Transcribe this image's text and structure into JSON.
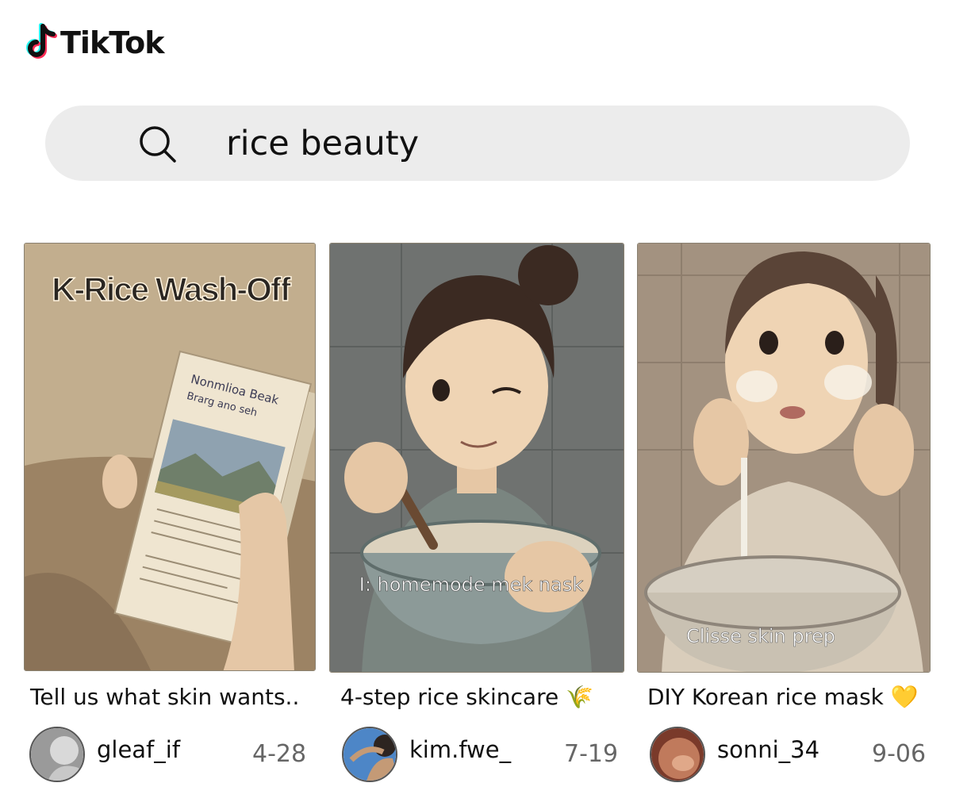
{
  "header": {
    "brand": "TikTok",
    "logo_icon": "music-note-icon"
  },
  "search": {
    "query": "rice beauty",
    "icon": "search-icon"
  },
  "videos": [
    {
      "overlay_title": "K-Rice Wash-Off",
      "package_text": [
        "Nonmlioa Beak",
        "Brarg ano seh"
      ],
      "caption": "Tell us what skin wants..",
      "username": "gleaf_if",
      "date": "4-28"
    },
    {
      "overlay_text": "I: homemode mek nask",
      "caption": "4-step rice skincare 🌾",
      "username": "kim.fwe_",
      "date": "7-19"
    },
    {
      "overlay_text": "Clisse skin prep",
      "caption": "DIY Korean rice mask 💛",
      "username": "sonni_34",
      "date": "9-06"
    }
  ],
  "colors": {
    "search_bg": "#ececec",
    "logo_cyan": "#25F4EE",
    "logo_pink": "#FE2C55",
    "date_gray": "#666666"
  }
}
